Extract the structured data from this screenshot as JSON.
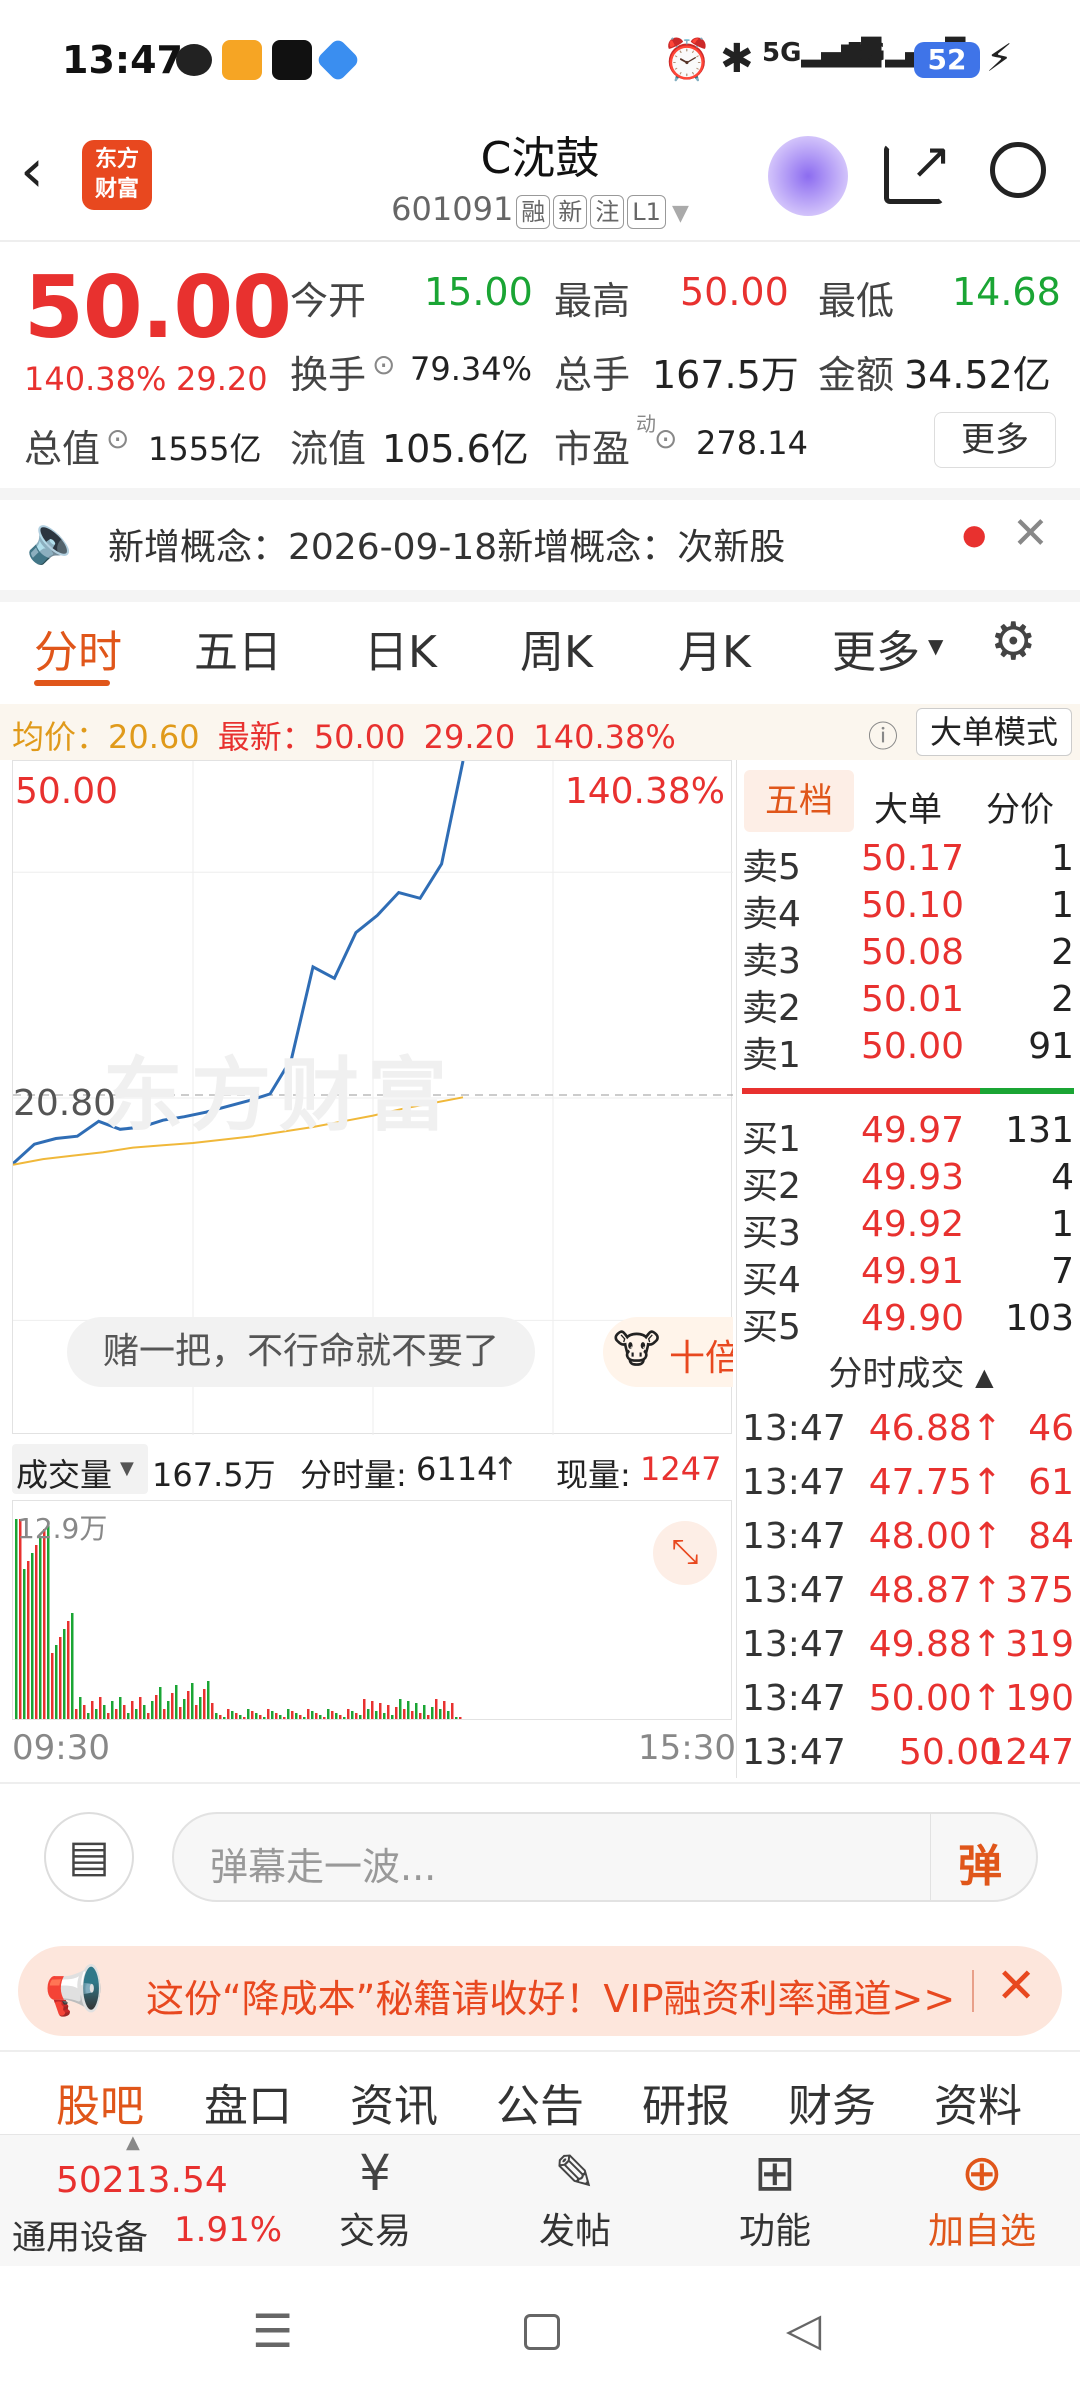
{
  "status": {
    "time": "13:47",
    "battery": "52"
  },
  "header": {
    "title": "C沈鼓",
    "code": "601091",
    "tags": [
      "融",
      "新",
      "注",
      "L1"
    ]
  },
  "quote": {
    "price": "50.00",
    "change_pct": "140.38%",
    "change_amt": "29.20",
    "open_label": "今开",
    "open": "15.00",
    "high_label": "最高",
    "high": "50.00",
    "low_label": "最低",
    "low": "14.68",
    "turnover_label": "换手",
    "turnover": "79.34%",
    "volume_label": "总手",
    "volume": "167.5万",
    "amount_label": "金额",
    "amount": "34.52亿",
    "mcap_label": "总值",
    "mcap": "1555亿",
    "float_label": "流值",
    "float": "105.6亿",
    "pe_label": "市盈",
    "pe_sup": "动",
    "pe": "278.14",
    "more": "更多"
  },
  "notice": {
    "text": "新增概念：2026-09-18新增概念：次新股"
  },
  "tabs": [
    "分时",
    "五日",
    "日K",
    "周K",
    "月K",
    "更多"
  ],
  "info_bar": {
    "avg_label": "均价：",
    "avg": "20.60",
    "latest_label": "最新：",
    "latest": "50.00",
    "chg": "29.20",
    "pct": "140.38%",
    "mode_btn": "大单模式"
  },
  "chart": {
    "top_price": "50.00",
    "top_pct": "140.38%",
    "base_price": "20.80",
    "watermark": "东方财富",
    "danmaku": "赌一把，不行命就不要了",
    "reward_text": "十倍"
  },
  "chart_data": {
    "type": "line",
    "x_start": "09:30",
    "x_end": "15:30",
    "ylim": [
      20.8,
      50.0
    ],
    "series": [
      {
        "values": [
          14.8,
          16.5,
          17.0,
          17.2,
          18.5,
          17.8,
          18.0,
          18.6,
          18.9,
          19.3,
          19.8,
          20.3,
          20.9,
          24.0,
          32.0,
          31.0,
          35.0,
          36.5,
          38.5,
          38.0,
          41.0,
          50.0
        ]
      },
      {
        "values": [
          14.7,
          15.2,
          15.5,
          15.8,
          16.2,
          16.4,
          16.6,
          16.9,
          17.2,
          17.6,
          18.0,
          18.5,
          19.0,
          19.6,
          20.1,
          20.6
        ]
      }
    ]
  },
  "vol_bar": {
    "label": "成交量",
    "total": "167.5万",
    "interval_label": "分时量:",
    "interval": "6114",
    "now_label": "现量:",
    "now": "1247",
    "max": "12.9万",
    "t_start": "09:30",
    "t_end": "15:30"
  },
  "orderbook": {
    "tabs": [
      "五档",
      "大单",
      "分价"
    ],
    "asks": [
      {
        "k": "卖5",
        "p": "50.17",
        "n": "1"
      },
      {
        "k": "卖4",
        "p": "50.10",
        "n": "1"
      },
      {
        "k": "卖3",
        "p": "50.08",
        "n": "2"
      },
      {
        "k": "卖2",
        "p": "50.01",
        "n": "2"
      },
      {
        "k": "卖1",
        "p": "50.00",
        "n": "91"
      }
    ],
    "bids": [
      {
        "k": "买1",
        "p": "49.97",
        "n": "131"
      },
      {
        "k": "买2",
        "p": "49.93",
        "n": "4"
      },
      {
        "k": "买3",
        "p": "49.92",
        "n": "1"
      },
      {
        "k": "买4",
        "p": "49.91",
        "n": "7"
      },
      {
        "k": "买5",
        "p": "49.90",
        "n": "103"
      }
    ],
    "ticks_title": "分时成交",
    "ticks": [
      {
        "t": "13:47",
        "p": "46.88↑",
        "n": "46"
      },
      {
        "t": "13:47",
        "p": "47.75↑",
        "n": "61"
      },
      {
        "t": "13:47",
        "p": "48.00↑",
        "n": "84"
      },
      {
        "t": "13:47",
        "p": "48.87↑",
        "n": "375"
      },
      {
        "t": "13:47",
        "p": "49.88↑",
        "n": "319"
      },
      {
        "t": "13:47",
        "p": "50.00↑",
        "n": "190"
      },
      {
        "t": "13:47",
        "p": "50.00",
        "n": "1247"
      }
    ]
  },
  "comment": {
    "placeholder": "弹幕走一波...",
    "send": "弹"
  },
  "banner": {
    "text": "这份“降成本”秘籍请收好！VIP融资利率通道>>"
  },
  "subnav": [
    "股吧",
    "盘口",
    "资讯",
    "公告",
    "研报",
    "财务",
    "资料"
  ],
  "bottom": {
    "index_val": "50213.54",
    "index_name": "通用设备",
    "index_pct": "1.91%",
    "items": [
      "交易",
      "发帖",
      "功能",
      "加自选"
    ]
  },
  "colors": {
    "up": "#e8312f",
    "down": "#1aa534",
    "accent": "#e0561a",
    "price_line": "#2f6db5",
    "avg_line": "#f0b83a"
  }
}
